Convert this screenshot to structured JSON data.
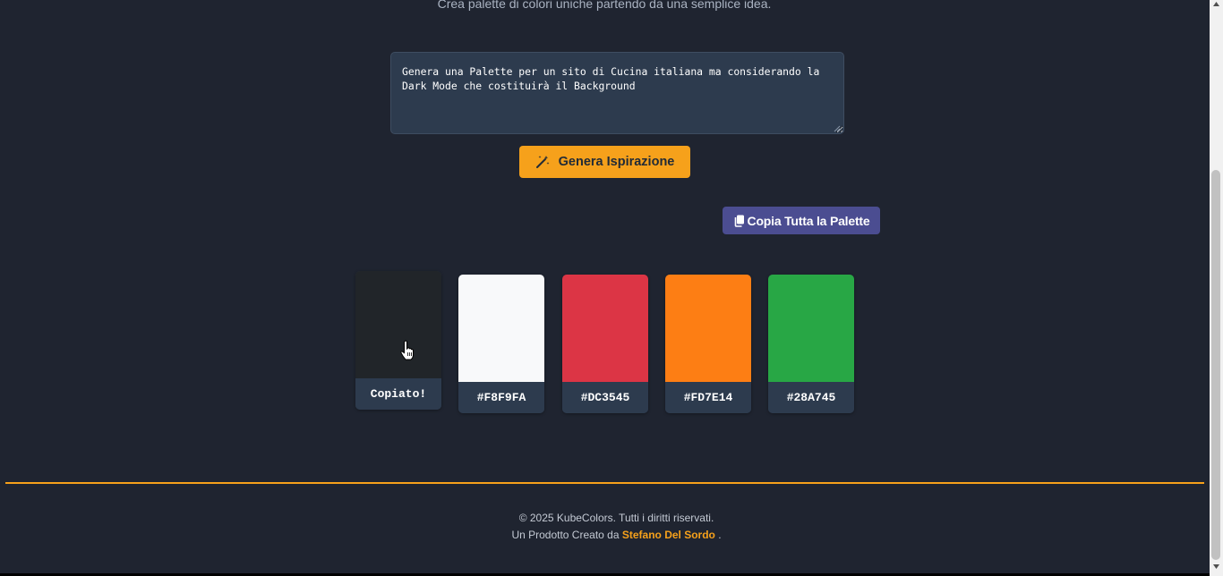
{
  "header": {
    "subtitle": "Crea palette di colori uniche partendo da una semplice idea."
  },
  "prompt": {
    "value": "Genera una Palette per un sito di Cucina italiana ma considerando la\nDark Mode che costituirà il Background"
  },
  "actions": {
    "generate_label": "Genera Ispirazione",
    "generate_icon": "magic-wand-icon",
    "copy_all_label": "Copia Tutta la Palette",
    "copy_all_icon": "copy-icon"
  },
  "palette": [
    {
      "hex": "#212529",
      "label": "Copiato!"
    },
    {
      "hex": "#F8F9FA",
      "label": "#F8F9FA"
    },
    {
      "hex": "#DC3545",
      "label": "#DC3545"
    },
    {
      "hex": "#FD7E14",
      "label": "#FD7E14"
    },
    {
      "hex": "#28A745",
      "label": "#28A745"
    }
  ],
  "footer": {
    "copyright": "© 2025 KubeColors. Tutti i diritti riservati.",
    "credit_prefix": "Un Prodotto Creato da",
    "credit_author": "Stefano Del Sordo",
    "credit_suffix": "."
  },
  "colors": {
    "background": "#1f2430",
    "accent": "#f6a11b",
    "copy_button": "#4b4d91",
    "input_background": "#2d3b4e"
  }
}
